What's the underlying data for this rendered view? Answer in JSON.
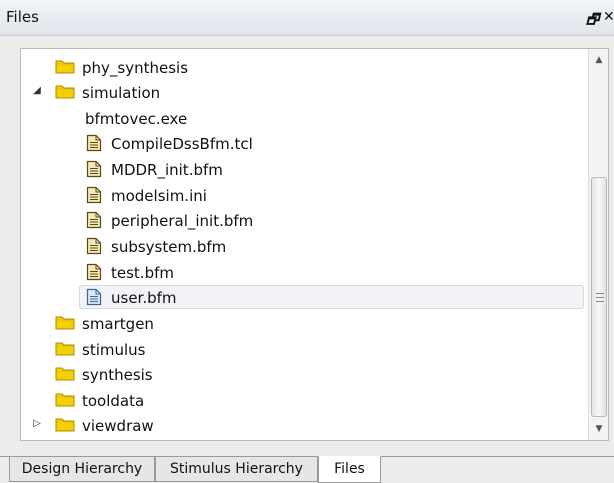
{
  "window": {
    "title": "Files",
    "restore_glyph": "🗗",
    "close_glyph": "✕"
  },
  "tree": {
    "items": [
      {
        "label": "phy_synthesis",
        "type": "folder",
        "expander": ""
      },
      {
        "label": "simulation",
        "type": "folder",
        "expander": "◢"
      },
      {
        "label": "bfmtovec.exe",
        "type": "plain",
        "expander": ""
      },
      {
        "label": "CompileDssBfm.tcl",
        "type": "file",
        "expander": ""
      },
      {
        "label": "MDDR_init.bfm",
        "type": "file",
        "expander": ""
      },
      {
        "label": "modelsim.ini",
        "type": "file",
        "expander": ""
      },
      {
        "label": "peripheral_init.bfm",
        "type": "file",
        "expander": ""
      },
      {
        "label": "subsystem.bfm",
        "type": "file",
        "expander": ""
      },
      {
        "label": "test.bfm",
        "type": "file",
        "expander": ""
      },
      {
        "label": "user.bfm",
        "type": "file-selected",
        "expander": ""
      },
      {
        "label": "smartgen",
        "type": "folder",
        "expander": ""
      },
      {
        "label": "stimulus",
        "type": "folder",
        "expander": ""
      },
      {
        "label": "synthesis",
        "type": "folder",
        "expander": ""
      },
      {
        "label": "tooldata",
        "type": "folder",
        "expander": ""
      },
      {
        "label": "viewdraw",
        "type": "folder",
        "expander": "▷"
      }
    ]
  },
  "scrollbar": {
    "up_glyph": "▲",
    "down_glyph": "▼"
  },
  "tabs": [
    {
      "label": "Design Hierarchy"
    },
    {
      "label": "Stimulus Hierarchy"
    },
    {
      "label": "Files"
    }
  ],
  "colors": {
    "folder": "#f5d000",
    "folder_edge": "#b08d00",
    "file": "#f3eab8",
    "file_edge": "#5a4a1a",
    "file_selected": "#dfe9f4",
    "file_selected_edge": "#3d6591"
  }
}
